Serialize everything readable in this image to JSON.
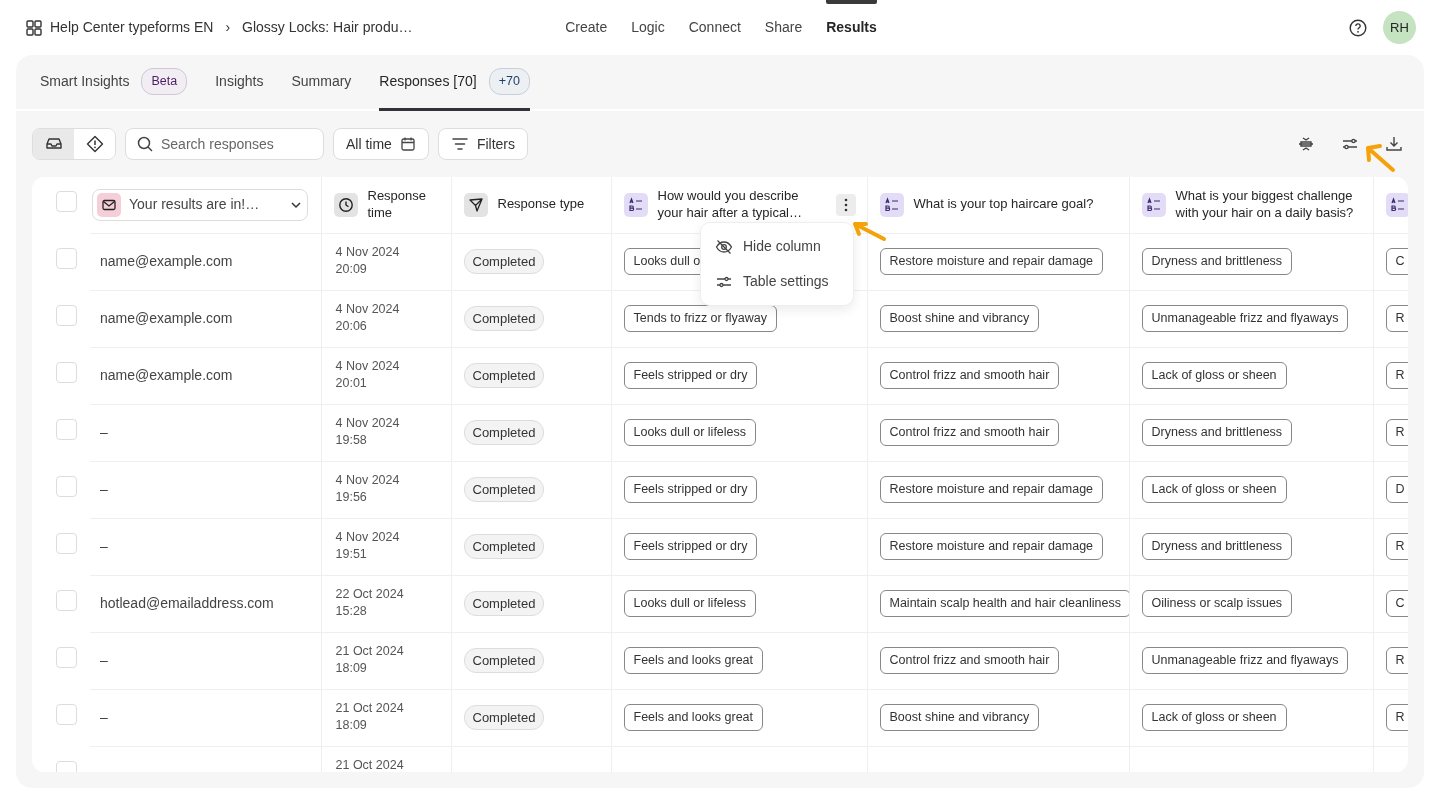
{
  "breadcrumb": {
    "workspace": "Help Center typeforms EN",
    "separator": "›",
    "form": "Glossy Locks: Hair produ…"
  },
  "nav": [
    {
      "label": "Create",
      "selected": false
    },
    {
      "label": "Logic",
      "selected": false
    },
    {
      "label": "Connect",
      "selected": false
    },
    {
      "label": "Share",
      "selected": false
    },
    {
      "label": "Results",
      "selected": true
    }
  ],
  "avatar": "RH",
  "tabs": [
    {
      "label": "Smart Insights",
      "selected": false,
      "badge": {
        "label": "Beta",
        "color": "#4b1f63"
      }
    },
    {
      "label": "Insights",
      "selected": false
    },
    {
      "label": "Summary",
      "selected": false
    },
    {
      "label": "Responses [70]",
      "selected": true,
      "badge": {
        "label": "+70",
        "color": "#1e3f6e"
      }
    }
  ],
  "toolbar": {
    "views": [
      {
        "kind": "inbox",
        "selected": true
      },
      {
        "kind": "alert",
        "selected": false
      }
    ],
    "search": {
      "placeholder": "Search responses"
    },
    "date_filter": "All time",
    "filters": "Filters"
  },
  "table": {
    "all_checked": false,
    "columns": [
      {
        "kind": "email",
        "label": "Your results are in!…"
      },
      {
        "kind": "time",
        "label": "Response time"
      },
      {
        "kind": "type",
        "label": "Response type"
      },
      {
        "kind": "choice",
        "label": "How would you describe your hair after a typical…",
        "menu_open": true
      },
      {
        "kind": "choice",
        "label": "What is your top haircare goal?"
      },
      {
        "kind": "choice",
        "label": "What is your biggest challenge with your hair on a daily basis?"
      },
      {
        "kind": "choice"
      }
    ],
    "rows": [
      {
        "checked": false,
        "email": "name@example.com",
        "date": "4 Nov 2024",
        "time": "20:09",
        "type": "Completed",
        "answers": [
          "Looks dull o",
          "Restore moisture and repair damage",
          "Dryness and brittleness",
          "C"
        ]
      },
      {
        "checked": false,
        "email": "name@example.com",
        "date": "4 Nov 2024",
        "time": "20:06",
        "type": "Completed",
        "answers": [
          "Tends to frizz or flyaway",
          "Boost shine and vibrancy",
          "Unmanageable frizz and flyaways",
          "R"
        ]
      },
      {
        "checked": false,
        "email": "name@example.com",
        "date": "4 Nov 2024",
        "time": "20:01",
        "type": "Completed",
        "answers": [
          "Feels stripped or dry",
          "Control frizz and smooth hair",
          "Lack of gloss or sheen",
          "R"
        ]
      },
      {
        "checked": false,
        "email": "–",
        "date": "4 Nov 2024",
        "time": "19:58",
        "type": "Completed",
        "answers": [
          "Looks dull or lifeless",
          "Control frizz and smooth hair",
          "Dryness and brittleness",
          "R"
        ]
      },
      {
        "checked": false,
        "email": "–",
        "date": "4 Nov 2024",
        "time": "19:56",
        "type": "Completed",
        "answers": [
          "Feels stripped or dry",
          "Restore moisture and repair damage",
          "Lack of gloss or sheen",
          "D"
        ]
      },
      {
        "checked": false,
        "email": "–",
        "date": "4 Nov 2024",
        "time": "19:51",
        "type": "Completed",
        "answers": [
          "Feels stripped or dry",
          "Restore moisture and repair damage",
          "Dryness and brittleness",
          "R"
        ]
      },
      {
        "checked": false,
        "email": "hotlead@emailaddress.com",
        "date": "22 Oct 2024",
        "time": "15:28",
        "type": "Completed",
        "answers": [
          "Looks dull or lifeless",
          "Maintain scalp health and hair cleanliness",
          "Oiliness or scalp issues",
          "C"
        ]
      },
      {
        "checked": false,
        "email": "–",
        "date": "21 Oct 2024",
        "time": "18:09",
        "type": "Completed",
        "answers": [
          "Feels and looks great",
          "Control frizz and smooth hair",
          "Unmanageable frizz and flyaways",
          "R"
        ]
      },
      {
        "checked": false,
        "email": "–",
        "date": "21 Oct 2024",
        "time": "18:09",
        "type": "Completed",
        "answers": [
          "Feels and looks great",
          "Boost shine and vibrancy",
          "Lack of gloss or sheen",
          "R"
        ]
      },
      {
        "checked": false,
        "date": "21 Oct 2024"
      }
    ]
  },
  "column_menu": {
    "items": [
      {
        "kind": "hide",
        "label": "Hide column"
      },
      {
        "kind": "settings",
        "label": "Table settings"
      }
    ]
  }
}
